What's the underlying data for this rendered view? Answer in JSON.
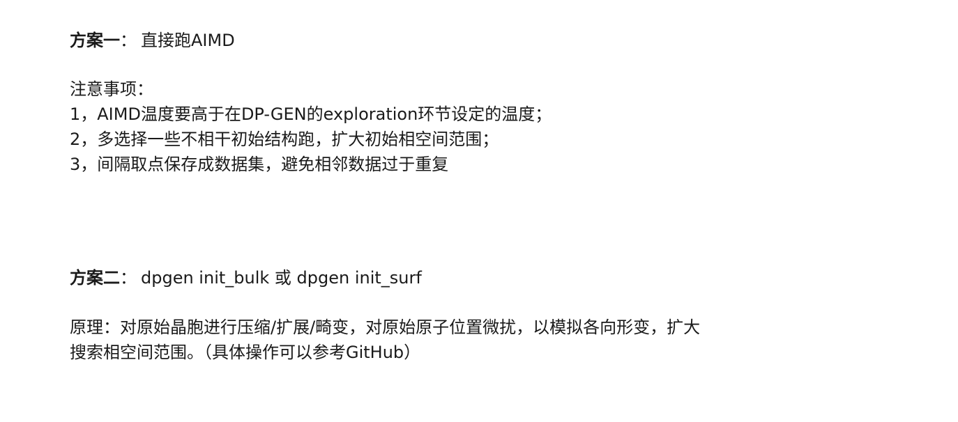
{
  "plan_one": {
    "label": "方案一",
    "separator": "：",
    "title": "直接跑AIMD"
  },
  "notes": {
    "heading": "注意事项：",
    "items": [
      "1，AIMD温度要高于在DP-GEN的exploration环节设定的温度；",
      "2，多选择一些不相干初始结构跑，扩大初始相空间范围；",
      "3，间隔取点保存成数据集，避免相邻数据过于重复"
    ]
  },
  "plan_two": {
    "label": "方案二",
    "separator": "：",
    "title": "dpgen init_bulk 或 dpgen init_surf"
  },
  "principle": {
    "lines": [
      "原理：对原始晶胞进行压缩/扩展/畸变，对原始原子位置微扰，以模拟各向形变，扩大",
      "搜索相空间范围。（具体操作可以参考GitHub）"
    ]
  }
}
